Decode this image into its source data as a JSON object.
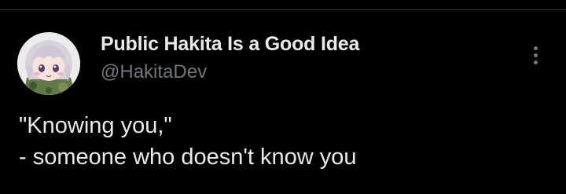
{
  "post": {
    "author": {
      "display_name": "Public Hakita Is a Good Idea",
      "handle": "@HakitaDev"
    },
    "text_lines": [
      "\"Knowing you,\"",
      "- someone who doesn't know you"
    ]
  },
  "icons": {
    "more": "more-vertical-icon",
    "avatar": "anime-character-avatar"
  },
  "colors": {
    "background": "#000000",
    "primary_text": "#e7e9ea",
    "secondary_text": "#71767b",
    "divider": "#2f3336"
  }
}
